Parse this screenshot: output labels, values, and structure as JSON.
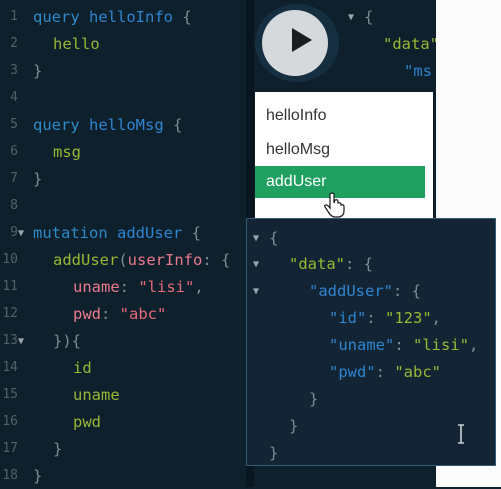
{
  "editor": {
    "line_numbers": [
      "1",
      "2",
      "3",
      "4",
      "5",
      "6",
      "7",
      "8",
      "9",
      "10",
      "11",
      "12",
      "13",
      "14",
      "15",
      "16",
      "17",
      "18"
    ],
    "code": {
      "kw_query": "query",
      "q1_name": "helloInfo",
      "q1_field": "hello",
      "q2_name": "helloMsg",
      "q2_field": "msg",
      "kw_mutation": "mutation",
      "m_name": "addUser",
      "m_call": "addUser",
      "arg_name": "userInfo",
      "uname_key": "uname",
      "uname_val": "\"lisi\"",
      "pwd_key": "pwd",
      "pwd_val": "\"abc\"",
      "sel_id": "id",
      "sel_uname": "uname",
      "sel_pwd": "pwd"
    }
  },
  "partial_result": {
    "data_key": "\"data\"",
    "msg_key": "\"ms"
  },
  "operation_menu": {
    "items": [
      "helloInfo",
      "helloMsg",
      "addUser"
    ],
    "selected": "addUser",
    "highlight_color": "#20a060"
  },
  "result": {
    "data_key": "\"data\"",
    "adduser_key": "\"addUser\"",
    "id_key": "\"id\"",
    "id_val": "\"123\"",
    "uname_key": "\"uname\"",
    "uname_val": "\"lisi\"",
    "pwd_key": "\"pwd\"",
    "pwd_val": "\"abc\""
  },
  "icons": {
    "run": "play-icon",
    "pointer": "hand-pointer-icon",
    "text_cursor": "ibeam-cursor-icon"
  }
}
